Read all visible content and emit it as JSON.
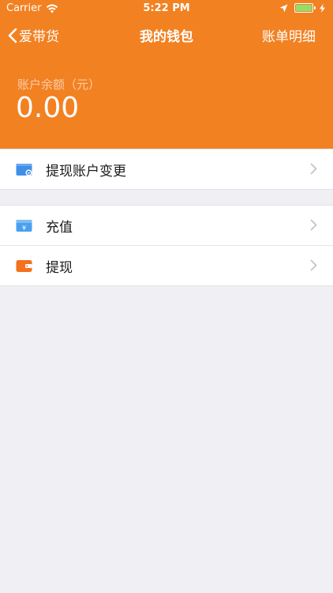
{
  "status_bar": {
    "carrier": "Carrier",
    "time": "5:22 PM"
  },
  "nav": {
    "back_label": "爱带货",
    "title": "我的钱包",
    "right_label": "账单明细"
  },
  "balance": {
    "label": "账户余额（元）",
    "value": "0.00"
  },
  "menu_groups": [
    {
      "items": [
        {
          "label": "提现账户变更",
          "icon": "wallet-change-icon"
        }
      ]
    },
    {
      "items": [
        {
          "label": "充值",
          "icon": "recharge-card-icon"
        },
        {
          "label": "提现",
          "icon": "withdraw-wallet-icon"
        }
      ]
    }
  ],
  "colors": {
    "header_bg": "#f28122",
    "page_bg": "#efeff4",
    "icon_blue": "#3f8fe8",
    "icon_orange": "#f4711d"
  }
}
